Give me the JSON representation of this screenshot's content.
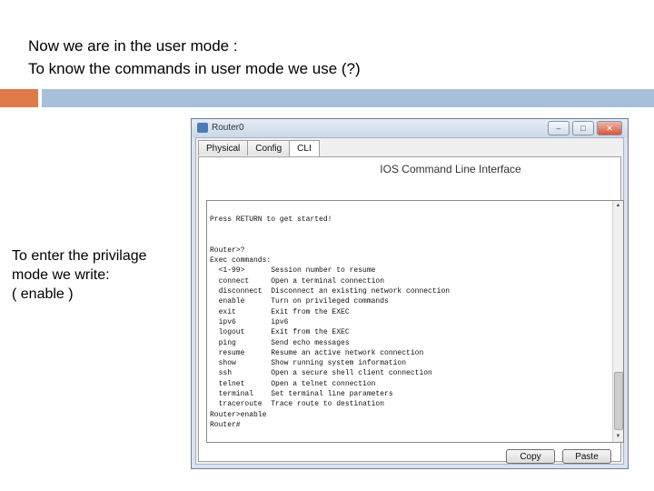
{
  "slide": {
    "heading_line1": "Now we are in the user mode :",
    "heading_line2": "To know the commands in user mode we use (?)",
    "note_line1": "To enter the privilage",
    "note_line2": "mode we write:",
    "note_line3": " ( enable )"
  },
  "window": {
    "title": "Router0",
    "controls": {
      "minimize": "–",
      "maximize": "□",
      "close": "✕"
    },
    "tabs": [
      {
        "label": "Physical"
      },
      {
        "label": "Config"
      },
      {
        "label": "CLI"
      }
    ],
    "active_tab": "CLI",
    "panel_heading": "IOS Command Line Interface",
    "terminal_lines": [
      "Press RETURN to get started!",
      "",
      "",
      "Router>?",
      "Exec commands:",
      "  <1-99>      Session number to resume",
      "  connect     Open a terminal connection",
      "  disconnect  Disconnect an existing network connection",
      "  enable      Turn on privileged commands",
      "  exit        Exit from the EXEC",
      "  ipv6        ipv6",
      "  logout      Exit from the EXEC",
      "  ping        Send echo messages",
      "  resume      Resume an active network connection",
      "  show        Show running system information",
      "  ssh         Open a secure shell client connection",
      "  telnet      Open a telnet connection",
      "  terminal    Set terminal line parameters",
      "  traceroute  Trace route to destination",
      "Router>enable",
      "Router#"
    ],
    "buttons": {
      "copy": "Copy",
      "paste": "Paste"
    }
  },
  "colors": {
    "accent_orange": "#e07a47",
    "accent_blue": "#a8bfd9",
    "window_frame": "#d9e3ef"
  }
}
